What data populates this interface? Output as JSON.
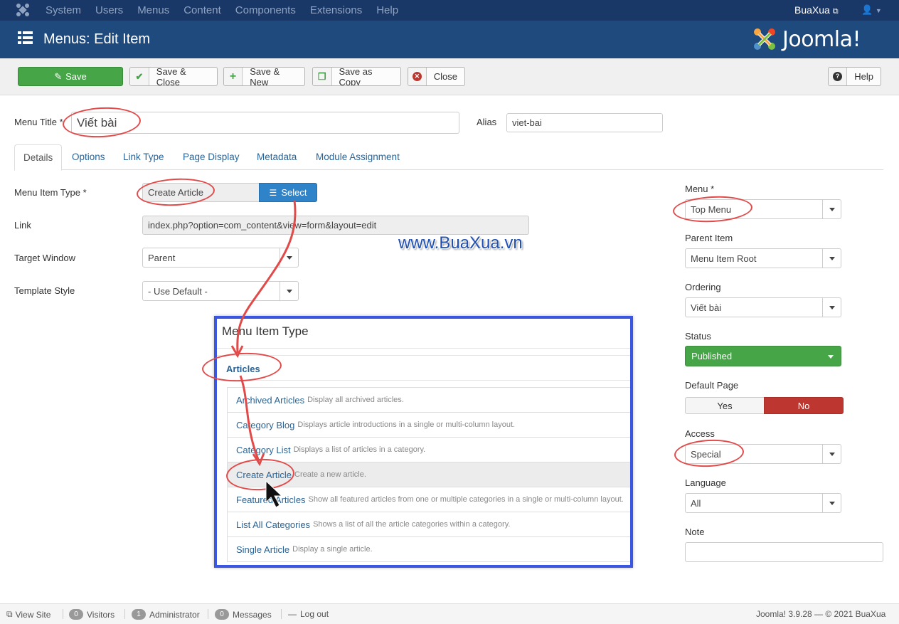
{
  "topnav": {
    "menu": [
      "System",
      "Users",
      "Menus",
      "Content",
      "Components",
      "Extensions",
      "Help"
    ],
    "site_name": "BuaXua",
    "user_icon": "user-icon"
  },
  "header": {
    "title": "Menus: Edit Item",
    "brand": "Joomla!"
  },
  "toolbar": {
    "save": "Save",
    "save_close": "Save & Close",
    "save_new": "Save & New",
    "save_copy": "Save as Copy",
    "close": "Close",
    "help": "Help"
  },
  "form": {
    "menu_title_label": "Menu Title *",
    "menu_title_value": "Viết bài",
    "alias_label": "Alias",
    "alias_value": "viet-bai",
    "tabs": [
      "Details",
      "Options",
      "Link Type",
      "Page Display",
      "Metadata",
      "Module Assignment"
    ],
    "item_type_label": "Menu Item Type *",
    "item_type_value": "Create Article",
    "select_label": "Select",
    "link_label": "Link",
    "link_value": "index.php?option=com_content&view=form&layout=edit",
    "target_label": "Target Window",
    "target_value": "Parent",
    "template_label": "Template Style",
    "template_value": "- Use Default -"
  },
  "watermark": "www.BuaXua.vn",
  "item_type_panel": {
    "title": "Menu Item Type",
    "group": "Articles",
    "items": [
      {
        "name": "Archived Articles",
        "desc": "Display all archived articles."
      },
      {
        "name": "Category Blog",
        "desc": "Displays article introductions in a single or multi-column layout."
      },
      {
        "name": "Category List",
        "desc": "Displays a list of articles in a category."
      },
      {
        "name": "Create Article",
        "desc": "Create a new article."
      },
      {
        "name": "Featured Articles",
        "desc": "Show all featured articles from one or multiple categories in a single or multi-column layout."
      },
      {
        "name": "List All Categories",
        "desc": "Shows a list of all the article categories within a category."
      },
      {
        "name": "Single Article",
        "desc": "Display a single article."
      }
    ]
  },
  "sidebar": {
    "menu_label": "Menu *",
    "menu_value": "Top Menu",
    "parent_label": "Parent Item",
    "parent_value": "Menu Item Root",
    "ordering_label": "Ordering",
    "ordering_value": "Viết bài",
    "status_label": "Status",
    "status_value": "Published",
    "default_label": "Default Page",
    "yes": "Yes",
    "no": "No",
    "access_label": "Access",
    "access_value": "Special",
    "language_label": "Language",
    "language_value": "All",
    "note_label": "Note"
  },
  "footer": {
    "view_site": "View Site",
    "visitors_count": "0",
    "visitors": "Visitors",
    "admin_count": "1",
    "admin": "Administrator",
    "messages_count": "0",
    "messages": "Messages",
    "logout": "Log out",
    "version": "Joomla! 3.9.28 — © 2021 BuaXua"
  },
  "colors": {
    "nav": "#1a3867",
    "header": "#1e4a7e",
    "save_green": "#46a546",
    "link_blue": "#2a6496",
    "no_red": "#bd362f",
    "annotation_red": "#e24a4a",
    "panel_border": "#3b56e0"
  }
}
